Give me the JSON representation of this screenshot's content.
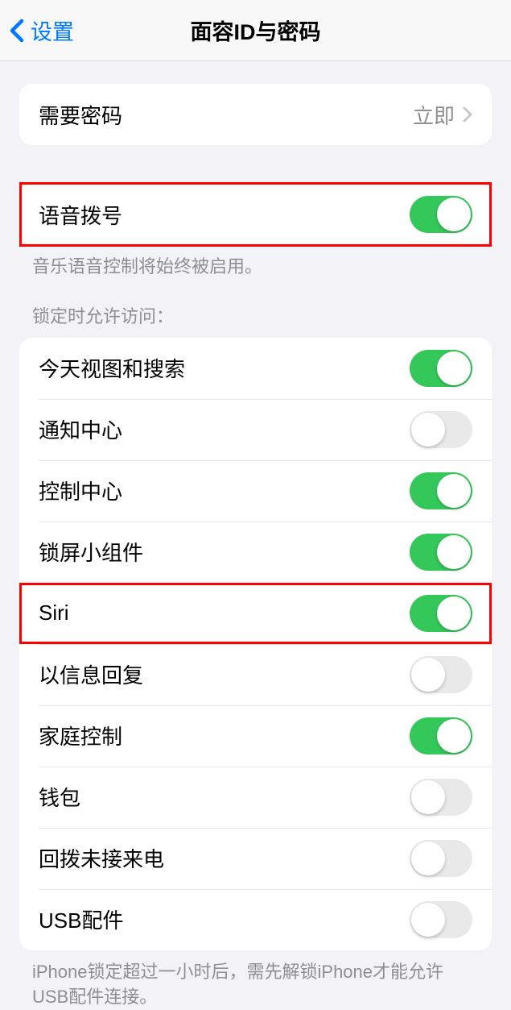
{
  "nav": {
    "back_label": "设置",
    "title": "面容ID与密码"
  },
  "passcode": {
    "label": "需要密码",
    "value": "立即"
  },
  "voice_dial": {
    "label": "语音拨号",
    "enabled": true,
    "footer": "音乐语音控制将始终被启用。"
  },
  "lock_access": {
    "header": "锁定时允许访问：",
    "items": [
      {
        "label": "今天视图和搜索",
        "enabled": true
      },
      {
        "label": "通知中心",
        "enabled": false
      },
      {
        "label": "控制中心",
        "enabled": true
      },
      {
        "label": "锁屏小组件",
        "enabled": true
      },
      {
        "label": "Siri",
        "enabled": true
      },
      {
        "label": "以信息回复",
        "enabled": false
      },
      {
        "label": "家庭控制",
        "enabled": true
      },
      {
        "label": "钱包",
        "enabled": false
      },
      {
        "label": "回拨未接来电",
        "enabled": false
      },
      {
        "label": "USB配件",
        "enabled": false
      }
    ],
    "footer": "iPhone锁定超过一小时后，需先解锁iPhone才能允许USB配件连接。"
  }
}
